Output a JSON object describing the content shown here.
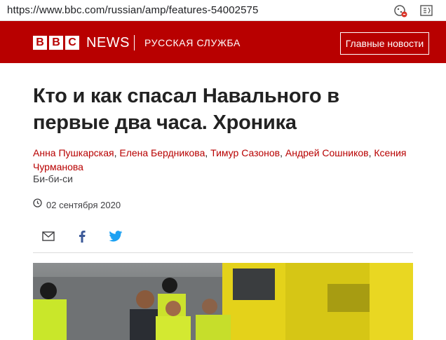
{
  "browser": {
    "url": "https://www.bbc.com/russian/amp/features-54002575",
    "icons": [
      "tracking-prevention-icon",
      "reader-mode-icon"
    ]
  },
  "header": {
    "logo_letters": [
      "B",
      "B",
      "C"
    ],
    "news_label": "NEWS",
    "service_label": "РУССКАЯ СЛУЖБА",
    "top_stories_button": "Главные новости",
    "brand_color": "#b80000"
  },
  "article": {
    "headline": "Кто и как спасал Навального в первые два часа. Хроника",
    "authors": [
      "Анна Пушкарская",
      "Елена Бердникова",
      "Тимур Сазонов",
      "Андрей Сошников",
      "Ксения Чурманова"
    ],
    "organization": "Би-би-си",
    "date": "02 сентября 2020"
  },
  "share": {
    "icons": [
      "email-icon",
      "facebook-icon",
      "twitter-icon"
    ],
    "twitter_color": "#1da1f2",
    "facebook_color": "#3b5998"
  }
}
